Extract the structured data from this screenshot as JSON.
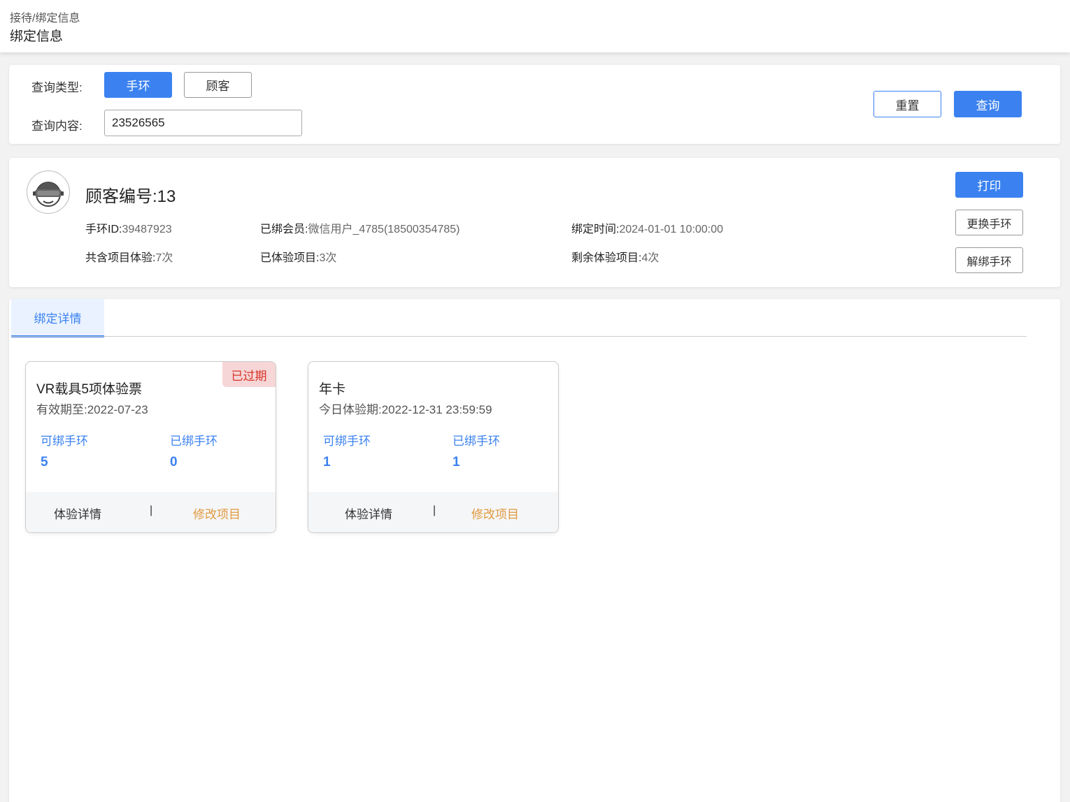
{
  "header": {
    "breadcrumb": "接待/绑定信息",
    "title": "绑定信息"
  },
  "query": {
    "type_label": "查询类型:",
    "type_options": [
      "手环",
      "顾客"
    ],
    "type_selected": "手环",
    "content_label": "查询内容:",
    "content_value": "23526565",
    "reset_label": "重置",
    "search_label": "查询"
  },
  "customer": {
    "avatar_icon": "vr-headset-avatar-icon",
    "title": "顾客编号:13",
    "wristband_label": "手环ID:",
    "wristband_value": "39487923",
    "member_label": "已绑会员:",
    "member_value": "微信用户_4785(18500354785)",
    "bind_time_label": "绑定时间:",
    "bind_time_value": "2024-01-01 10:00:00",
    "total_label": "共含项目体验:",
    "total_value": "7次",
    "used_label": "已体验项目:",
    "used_value": "3次",
    "remaining_label": "剩余体验项目:",
    "remaining_value": "4次",
    "print_label": "打印",
    "change_label": "更换手环",
    "unbind_label": "解绑手环"
  },
  "tabs": {
    "active": "绑定详情"
  },
  "passes": [
    {
      "name": "VR载具5项体验票",
      "date": "有效期至:2022-07-23",
      "badge": "已过期",
      "bindable_label": "可绑手环",
      "bindable_value": "5",
      "bound_label": "已绑手环",
      "bound_value": "0",
      "detail_label": "体验详情",
      "separator": "|",
      "edit_label": "修改项目"
    },
    {
      "name": "年卡",
      "date": "今日体验期:2022-12-31  23:59:59",
      "badge": "",
      "bindable_label": "可绑手环",
      "bindable_value": "1",
      "bound_label": "已绑手环",
      "bound_value": "1",
      "detail_label": "体验详情",
      "separator": "|",
      "edit_label": "修改项目"
    }
  ],
  "colors": {
    "primary": "#3b82f0",
    "expired_bg": "#f6d6d6",
    "expired_text": "#d9342b",
    "edit_text": "#e09a40"
  }
}
